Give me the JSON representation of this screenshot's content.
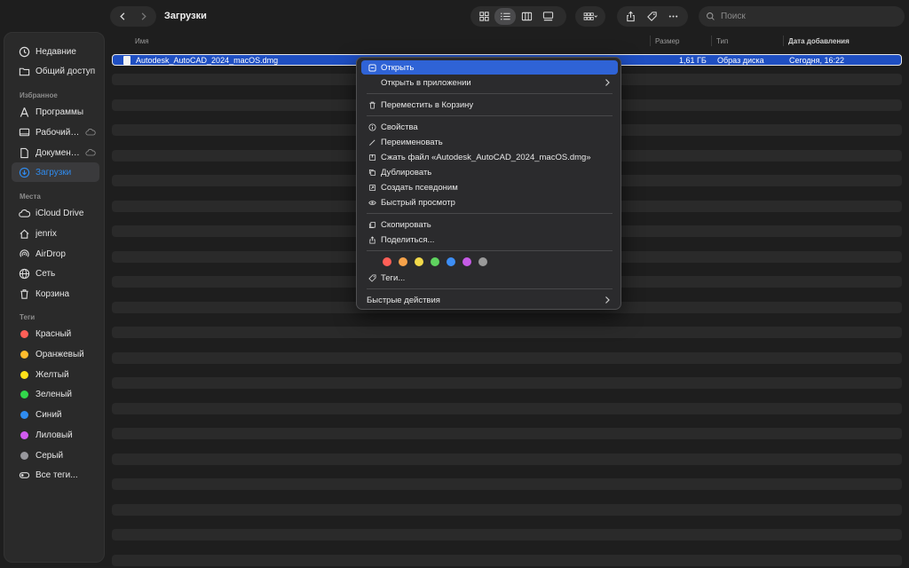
{
  "window": {
    "title": "Загрузки"
  },
  "search": {
    "placeholder": "Поиск"
  },
  "sidebar": {
    "recents": "Недавние",
    "shared": "Общий доступ",
    "favorites_header": "Избранное",
    "favorites": [
      {
        "label": "Программы",
        "icon": "apps-icon"
      },
      {
        "label": "Рабочий с...",
        "icon": "desktop-icon",
        "cloud": true
      },
      {
        "label": "Документы",
        "icon": "document-icon",
        "cloud": true
      },
      {
        "label": "Загрузки",
        "icon": "download-icon",
        "active": true
      }
    ],
    "places_header": "Места",
    "places": [
      {
        "label": "iCloud Drive",
        "icon": "cloud-icon"
      },
      {
        "label": "jenrix",
        "icon": "home-icon"
      },
      {
        "label": "AirDrop",
        "icon": "airdrop-icon"
      },
      {
        "label": "Сеть",
        "icon": "globe-icon"
      },
      {
        "label": "Корзина",
        "icon": "trash-icon"
      }
    ],
    "tags_header": "Теги",
    "tags": [
      {
        "label": "Красный",
        "color": "#ff5f57"
      },
      {
        "label": "Оранжевый",
        "color": "#febc2e"
      },
      {
        "label": "Желтый",
        "color": "#ffe11a"
      },
      {
        "label": "Зеленый",
        "color": "#32d74b"
      },
      {
        "label": "Синий",
        "color": "#2f8cf0"
      },
      {
        "label": "Лиловый",
        "color": "#d25bf0"
      },
      {
        "label": "Серый",
        "color": "#98989d"
      }
    ],
    "all_tags": "Все теги..."
  },
  "columns": {
    "name": "Имя",
    "size": "Размер",
    "kind": "Тип",
    "date_added": "Дата добавления"
  },
  "files": [
    {
      "name": "Autodesk_AutoCAD_2024_macOS.dmg",
      "size": "1,61 ГБ",
      "kind": "Образ диска",
      "date_added": "Сегодня, 16:22"
    }
  ],
  "context_menu": {
    "items_group1": [
      "Открыть",
      "Открыть в приложении"
    ],
    "items_group2": [
      "Переместить в Корзину"
    ],
    "items_group3": [
      "Свойства",
      "Переименовать",
      "Сжать файл «Autodesk_AutoCAD_2024_macOS.dmg»",
      "Дублировать",
      "Создать псевдоним",
      "Быстрый просмотр"
    ],
    "items_group4": [
      "Скопировать",
      "Поделиться..."
    ],
    "tag_colors": [
      "#ff5f57",
      "#f6a24a",
      "#f2d94a",
      "#5fd35f",
      "#3d8ef5",
      "#c65be6",
      "#9a9a9a"
    ],
    "tags_label": "Теги...",
    "quick_actions": "Быстрые действия"
  },
  "colors": {
    "accent": "#2f63d6",
    "selection": "#1f4fc2"
  }
}
